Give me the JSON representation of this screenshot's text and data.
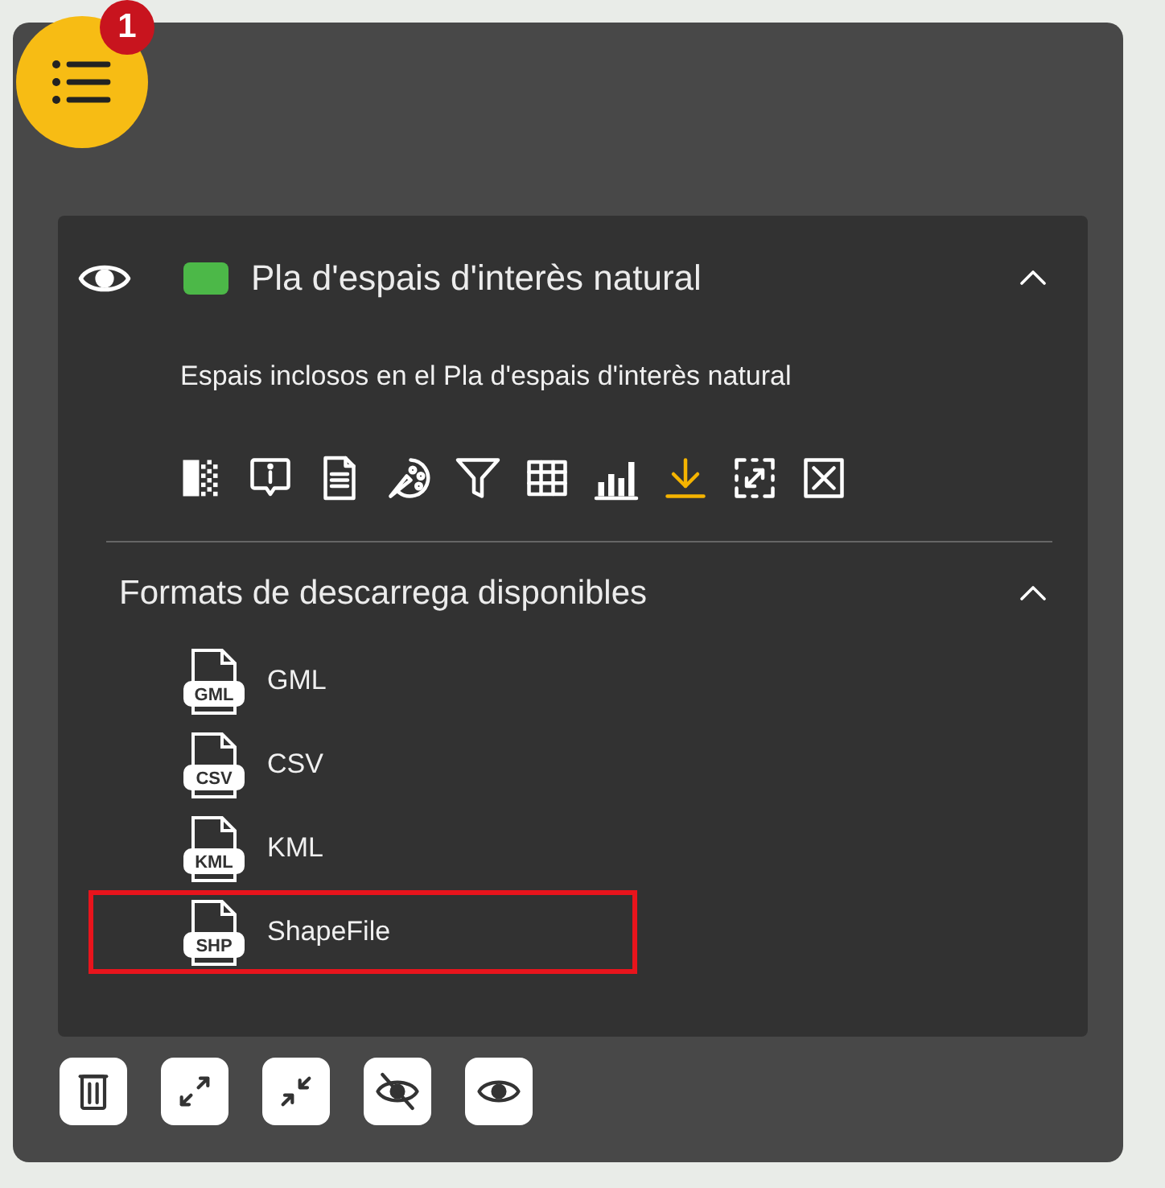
{
  "menu_button": {
    "badge": "1"
  },
  "layer": {
    "visible": true,
    "color": "#4cb848",
    "title": "Pla d'espais d'interès natural",
    "expanded": true,
    "description": "Espais inclosos en el Pla d'espais d'interès natural",
    "tools": [
      {
        "kind": "transparency",
        "selected": false
      },
      {
        "kind": "info",
        "selected": false
      },
      {
        "kind": "metadata",
        "selected": false
      },
      {
        "kind": "style",
        "selected": false
      },
      {
        "kind": "filter",
        "selected": false
      },
      {
        "kind": "table",
        "selected": false
      },
      {
        "kind": "chart",
        "selected": false
      },
      {
        "kind": "download",
        "selected": true
      },
      {
        "kind": "zoom",
        "selected": false
      },
      {
        "kind": "remove",
        "selected": false
      }
    ]
  },
  "downloads": {
    "title": "Formats de descarrega disponibles",
    "expanded": true,
    "formats": [
      {
        "tag": "GML",
        "label": "GML",
        "highlighted": false
      },
      {
        "tag": "CSV",
        "label": "CSV",
        "highlighted": false
      },
      {
        "tag": "KML",
        "label": "KML",
        "highlighted": false
      },
      {
        "tag": "SHP",
        "label": "ShapeFile",
        "highlighted": true
      }
    ]
  },
  "footer_buttons": [
    {
      "kind": "delete"
    },
    {
      "kind": "expand"
    },
    {
      "kind": "collapse"
    },
    {
      "kind": "hide"
    },
    {
      "kind": "show"
    }
  ]
}
